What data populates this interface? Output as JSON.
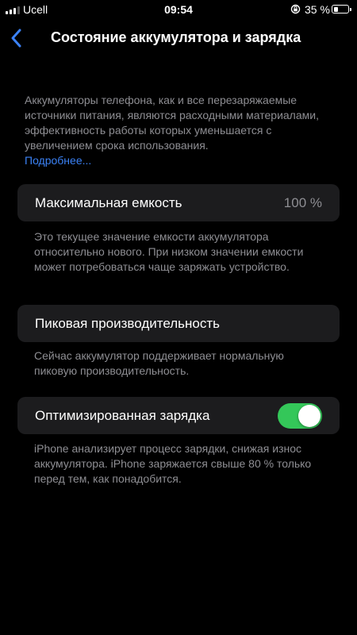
{
  "status_bar": {
    "carrier": "Ucell",
    "time": "09:54",
    "battery_percent": "35 %",
    "battery_level": 0.35
  },
  "nav": {
    "title": "Состояние аккумулятора и зарядка"
  },
  "intro": {
    "text": "Аккумуляторы телефона, как и все перезаряжаемые источники питания, являются расходными материалами, эффективность работы которых уменьшается с увеличением срока использования.",
    "link": "Подробнее..."
  },
  "max_capacity": {
    "label": "Максимальная емкость",
    "value": "100 %",
    "footer": "Это текущее значение емкости аккумулятора относительно нового. При низком значении емкости может потребоваться чаще заряжать устройство."
  },
  "peak_performance": {
    "label": "Пиковая производительность",
    "footer": "Сейчас аккумулятор поддерживает нормальную пиковую производительность."
  },
  "optimized_charging": {
    "label": "Оптимизированная зарядка",
    "enabled": true,
    "footer": "iPhone анализирует процесс зарядки, снижая износ аккумулятора. iPhone заряжается свыше 80 % только перед тем, как понадобится."
  },
  "colors": {
    "background": "#000000",
    "cell": "#1c1c1e",
    "secondary_text": "#8e8e93",
    "link": "#3b82f6",
    "toggle_on": "#34c759"
  }
}
